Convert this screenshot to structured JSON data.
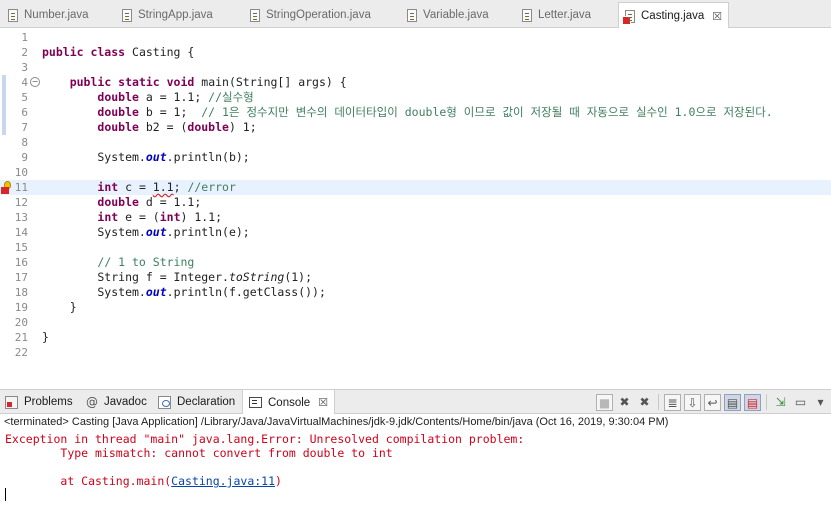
{
  "editor_tabs": [
    {
      "label": "Number.java",
      "active": false,
      "error": false
    },
    {
      "label": "StringApp.java",
      "active": false,
      "error": false
    },
    {
      "label": "StringOperation.java",
      "active": false,
      "error": false
    },
    {
      "label": "Variable.java",
      "active": false,
      "error": false
    },
    {
      "label": "Letter.java",
      "active": false,
      "error": false
    },
    {
      "label": "Casting.java",
      "active": true,
      "error": true,
      "close": "☒"
    }
  ],
  "editor": {
    "line_numbers": [
      "1",
      "2",
      "3",
      "4",
      "5",
      "6",
      "7",
      "8",
      "9",
      "10",
      "11",
      "12",
      "13",
      "14",
      "15",
      "16",
      "17",
      "18",
      "19",
      "20",
      "21",
      "22"
    ],
    "current_line": 11,
    "error_line": 11,
    "fold_marker": "⊖",
    "lines": [
      [],
      [
        [
          "public class ",
          "kw"
        ],
        [
          "Casting {",
          ""
        ]
      ],
      [],
      [
        [
          "    ",
          ""
        ],
        [
          "public static void ",
          "kw"
        ],
        [
          "main(String[] args) {",
          ""
        ]
      ],
      [
        [
          "        ",
          ""
        ],
        [
          "double ",
          "kw"
        ],
        [
          "a = 1.1; ",
          ""
        ],
        [
          "//실수형",
          "cm"
        ]
      ],
      [
        [
          "        ",
          ""
        ],
        [
          "double ",
          "kw"
        ],
        [
          "b = 1;  ",
          ""
        ],
        [
          "// 1은 정수지만 변수의 데이터타입이 double형 이므로 값이 저장될 때 자동으로 실수인 1.0으로 저장된다.",
          "cm"
        ]
      ],
      [
        [
          "        ",
          ""
        ],
        [
          "double ",
          "kw"
        ],
        [
          "b2 = (",
          ""
        ],
        [
          "double",
          "kw"
        ],
        [
          ") 1;",
          ""
        ]
      ],
      [],
      [
        [
          "        System.",
          ""
        ],
        [
          "out",
          "fld"
        ],
        [
          ".println(b);",
          ""
        ]
      ],
      [],
      [
        [
          "        ",
          ""
        ],
        [
          "int ",
          "kw"
        ],
        [
          "c = ",
          ""
        ],
        [
          "1.1",
          "squig"
        ],
        [
          "; ",
          ""
        ],
        [
          "//error",
          "cm"
        ]
      ],
      [
        [
          "        ",
          ""
        ],
        [
          "double ",
          "kw"
        ],
        [
          "d = 1.1;",
          ""
        ]
      ],
      [
        [
          "        ",
          ""
        ],
        [
          "int ",
          "kw"
        ],
        [
          "e = (",
          ""
        ],
        [
          "int",
          "kw"
        ],
        [
          ") 1.1;",
          ""
        ]
      ],
      [
        [
          "        System.",
          ""
        ],
        [
          "out",
          "fld"
        ],
        [
          ".println(e);",
          ""
        ]
      ],
      [],
      [
        [
          "        ",
          ""
        ],
        [
          "// 1 to String",
          "cm"
        ]
      ],
      [
        [
          "        String f = Integer.",
          ""
        ],
        [
          "toString",
          "it"
        ],
        [
          "(1);",
          ""
        ]
      ],
      [
        [
          "        System.",
          ""
        ],
        [
          "out",
          "fld"
        ],
        [
          ".println(f.getClass());",
          ""
        ]
      ],
      [
        [
          "    }",
          ""
        ]
      ],
      [],
      [
        [
          "}",
          ""
        ]
      ],
      []
    ]
  },
  "view_tabs": [
    {
      "label": "Problems",
      "icon": "problems-icon",
      "active": false
    },
    {
      "label": "Javadoc",
      "icon": "javadoc-icon",
      "glyph": "@",
      "active": false
    },
    {
      "label": "Declaration",
      "icon": "declaration-icon",
      "active": false
    },
    {
      "label": "Console",
      "icon": "console-icon",
      "active": true,
      "close": "☒"
    }
  ],
  "console_toolbar": [
    {
      "name": "terminate-button-icon",
      "glyph": "■",
      "style": "sq dim"
    },
    {
      "name": "remove-launch-icon",
      "glyph": "✖",
      "style": ""
    },
    {
      "name": "remove-all-terminated-icon",
      "glyph": "✖",
      "style": ""
    },
    {
      "sep": true
    },
    {
      "name": "clear-console-icon",
      "glyph": "≣",
      "style": "sq"
    },
    {
      "name": "scroll-lock-icon",
      "glyph": "⇩",
      "style": "sq"
    },
    {
      "name": "word-wrap-icon",
      "glyph": "↩",
      "style": "sq"
    },
    {
      "name": "show-on-stdout-icon",
      "glyph": "▤",
      "style": "sq pressed"
    },
    {
      "name": "show-on-stderr-icon",
      "glyph": "▤",
      "style": "sq pressed red"
    },
    {
      "sep": true
    },
    {
      "name": "pin-console-icon",
      "glyph": "⇲",
      "style": "grn"
    },
    {
      "name": "display-console-icon",
      "glyph": "▭",
      "style": ""
    },
    {
      "name": "console-menu-icon",
      "glyph": "▾",
      "style": ""
    }
  ],
  "console": {
    "header": "<terminated> Casting [Java Application] /Library/Java/JavaVirtualMachines/jdk-9.jdk/Contents/Home/bin/java (Oct 16, 2019, 9:30:04 PM)",
    "line1": "Exception in thread \"main\" java.lang.Error: Unresolved compilation problem: ",
    "line2": "\tType mismatch: cannot convert from double to int",
    "line3_prefix": "\tat Casting.main(",
    "line3_link": "Casting.java:11",
    "line3_suffix": ")"
  },
  "colors": {
    "keyword": "#7f0055",
    "comment": "#3f7f5f",
    "field": "#0000c0",
    "error_text": "#d0021b",
    "current_line_bg": "#e8f2fe"
  }
}
